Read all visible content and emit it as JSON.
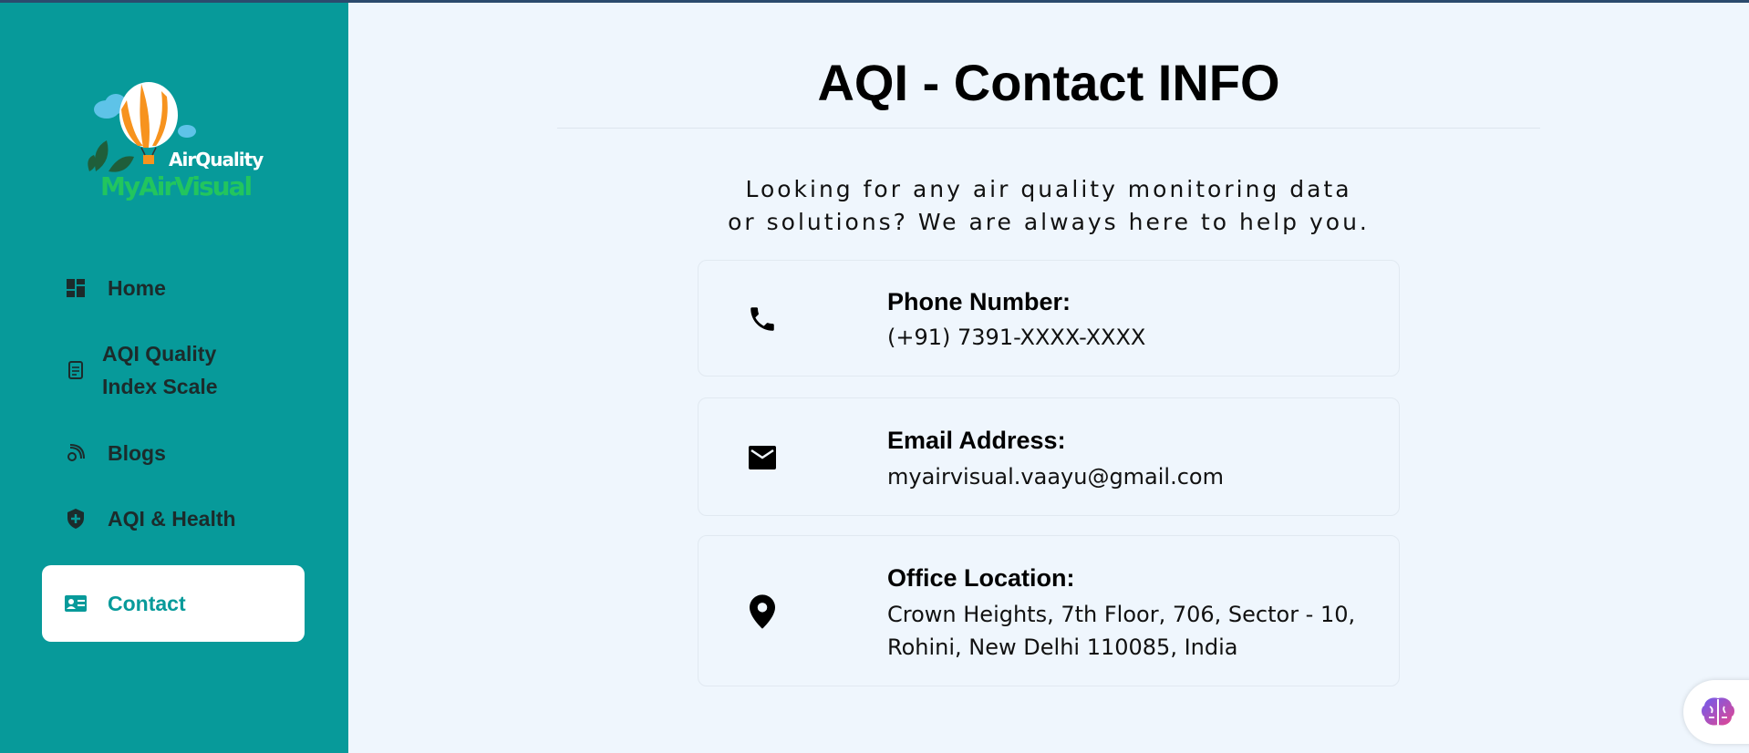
{
  "brand": {
    "small_text": "AirQuality",
    "big_text": "MyAirVisual"
  },
  "sidebar": {
    "items": [
      {
        "label": "Home",
        "icon": "dashboard-icon"
      },
      {
        "label_line1": "AQI Quality",
        "label_line2": "Index Scale",
        "icon": "document-icon"
      },
      {
        "label": "Blogs",
        "icon": "blog-icon"
      },
      {
        "label": "AQI & Health",
        "icon": "shield-icon"
      },
      {
        "label": "Contact",
        "icon": "contact-card-icon",
        "active": true
      }
    ]
  },
  "main": {
    "title": "AQI - Contact INFO",
    "subtitle_line1": "Looking for any air quality monitoring data",
    "subtitle_line2": "or solutions? We are always here to help you.",
    "cards": [
      {
        "heading": "Phone Number:",
        "value": "(+91) 7391-XXXX-XXXX",
        "icon": "phone-icon"
      },
      {
        "heading": "Email Address:",
        "value": "myairvisual.vaayu@gmail.com",
        "icon": "mail-icon"
      },
      {
        "heading": "Office Location:",
        "value_line1": "Crown Heights, 7th Floor, 706, Sector - 10,",
        "value_line2": "Rohini, New Delhi 110085, India",
        "icon": "location-pin-icon"
      }
    ]
  },
  "colors": {
    "sidebar": "#079a9a",
    "page_bg": "#eff6fd",
    "active_text": "#079a9a",
    "logo_green": "#22c55e"
  },
  "assistant_button": {
    "icon": "brain-icon"
  }
}
